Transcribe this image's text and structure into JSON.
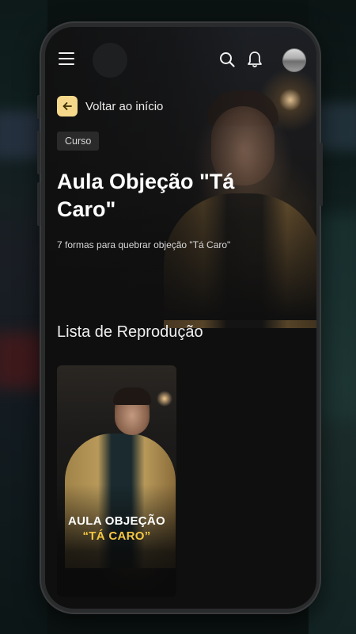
{
  "header": {
    "menu_icon": "hamburger-menu-icon",
    "search_icon": "search-icon",
    "notification_icon": "bell-icon",
    "avatar_icon": "user-avatar"
  },
  "back": {
    "label": "Voltar ao início",
    "icon": "arrow-left-icon",
    "accent_color": "#f5d88a"
  },
  "course": {
    "badge": "Curso",
    "title": "Aula Objeção \"Tá Caro\"",
    "description": "7 formas para quebrar objeção \"Tá Caro\""
  },
  "playlist": {
    "section_title": "Lista de Reprodução",
    "items": [
      {
        "line1": "AULA OBJEÇÃO",
        "line2": "“TÁ CARO”",
        "highlight_color": "#f5c842"
      }
    ]
  }
}
